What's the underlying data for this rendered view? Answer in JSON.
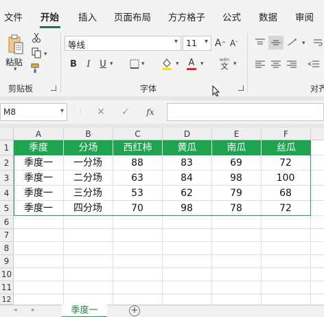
{
  "tabs": [
    {
      "label": "文件",
      "active": false
    },
    {
      "label": "开始",
      "active": true
    },
    {
      "label": "插入",
      "active": false
    },
    {
      "label": "页面布局",
      "active": false
    },
    {
      "label": "方方格子",
      "active": false
    },
    {
      "label": "公式",
      "active": false
    },
    {
      "label": "数据",
      "active": false
    },
    {
      "label": "审阅",
      "active": false
    }
  ],
  "ribbon": {
    "clipboard": {
      "paste_label": "粘贴",
      "group_label": "剪贴板"
    },
    "font": {
      "font_name": "等线",
      "font_size": "11",
      "group_label": "字体",
      "bold": "B",
      "italic": "I",
      "underline": "U",
      "wen": "wén",
      "wen_char": "文",
      "grow": "A",
      "shrink": "A"
    },
    "alignment": {
      "group_label": "对齐"
    }
  },
  "formula_bar": {
    "cell_ref": "M8",
    "fx": "fx",
    "value": ""
  },
  "columns": [
    "A",
    "B",
    "C",
    "D",
    "E",
    "F"
  ],
  "rows": [
    "1",
    "2",
    "3",
    "4",
    "5",
    "6",
    "7",
    "8",
    "9",
    "10",
    "11",
    "12"
  ],
  "table": {
    "header": [
      "季度",
      "分场",
      "西红柿",
      "黄瓜",
      "南瓜",
      "丝瓜"
    ],
    "rows": [
      [
        "季度一",
        "一分场",
        "88",
        "83",
        "69",
        "72"
      ],
      [
        "季度一",
        "二分场",
        "63",
        "84",
        "98",
        "100"
      ],
      [
        "季度一",
        "三分场",
        "53",
        "62",
        "79",
        "68"
      ],
      [
        "季度一",
        "四分场",
        "70",
        "98",
        "78",
        "72"
      ]
    ]
  },
  "sheet_tab": "季度一",
  "colors": {
    "header_fill": "#1ea34f",
    "accent": "#217346",
    "font_color": "#e02020",
    "highlight": "#ffe000"
  }
}
